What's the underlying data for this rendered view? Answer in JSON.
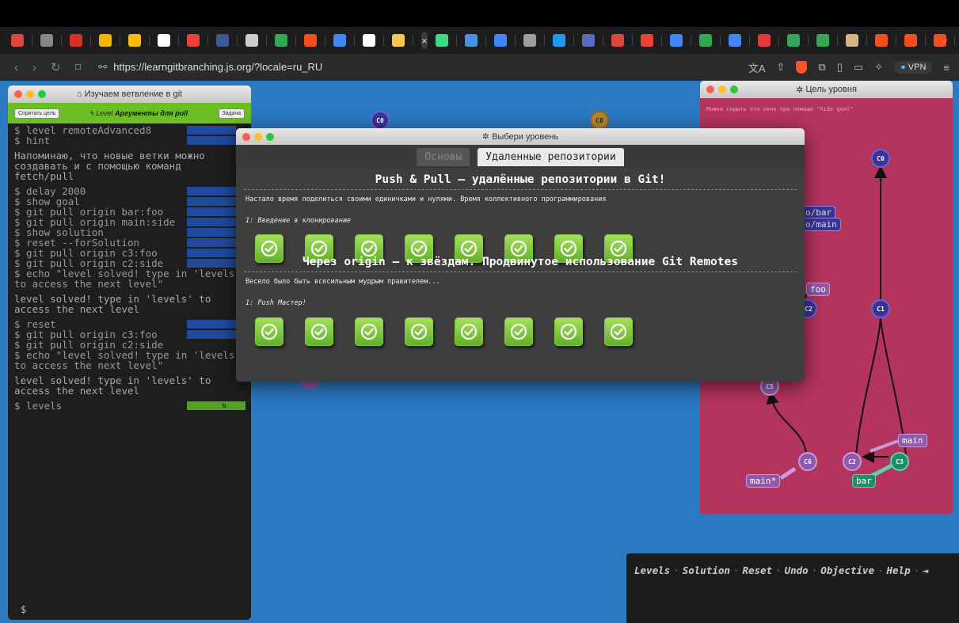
{
  "browser": {
    "url": "https://learngitbranching.js.org/?locale=ru_RU",
    "vpn_label": "VPN",
    "tabs": [
      {
        "color": "#e0453b"
      },
      {
        "color": "#888888"
      },
      {
        "color": "#d93025"
      },
      {
        "color": "#f4b400"
      },
      {
        "color": "#fbbc04"
      },
      {
        "color": "#ffffff"
      },
      {
        "color": "#ea4335"
      },
      {
        "color": "#3b5998"
      },
      {
        "color": "#cccccc"
      },
      {
        "color": "#34a853"
      },
      {
        "color": "#f24e1e"
      },
      {
        "color": "#4285f4"
      },
      {
        "color": "#ffffff"
      },
      {
        "color": "#f9c74f"
      },
      {
        "active": true
      },
      {
        "color": "#3ddc84"
      },
      {
        "color": "#4a90e2"
      },
      {
        "color": "#4285f4"
      },
      {
        "color": "#9e9e9e"
      },
      {
        "color": "#2196f3"
      },
      {
        "color": "#5c6bc0"
      },
      {
        "color": "#e0453b"
      },
      {
        "color": "#ea4335"
      },
      {
        "color": "#4285f4"
      },
      {
        "color": "#34a853"
      },
      {
        "color": "#4285f4"
      },
      {
        "color": "#e53935"
      },
      {
        "color": "#34a853"
      },
      {
        "color": "#34a853"
      },
      {
        "color": "#d4b483"
      },
      {
        "color": "#f24e1e"
      },
      {
        "color": "#f24e1e"
      },
      {
        "color": "#f24e1e"
      },
      {
        "color": "#ea4335"
      }
    ],
    "active_tab_glyph": "×",
    "new_tab_glyph": "+"
  },
  "terminal": {
    "title": "Изучаем ветвление в git",
    "hide_goal_label": "Спрятать цель",
    "level_prefix": "Level",
    "level_name": "Аргументы для pull",
    "task_label": "Задача",
    "lines": [
      {
        "type": "cmd",
        "text": "$ level remoteAdvanced8",
        "hl": "blue"
      },
      {
        "type": "cmd",
        "text": "$ hint",
        "hl": "blue"
      },
      {
        "type": "out",
        "text": "Напоминаю, что новые ветки можно создавать и с помощью команд fetch/pull"
      },
      {
        "type": "cmd",
        "text": "$ delay 2000",
        "hl": "blue"
      },
      {
        "type": "cmd",
        "text": "$ show goal",
        "hl": "blue"
      },
      {
        "type": "cmd",
        "text": "$ git pull origin bar:foo",
        "hl": "blue"
      },
      {
        "type": "cmd",
        "text": "$ git pull origin main:side",
        "hl": "blue"
      },
      {
        "type": "cmd",
        "text": "$ show solution",
        "hl": "blue"
      },
      {
        "type": "cmd",
        "text": "$ reset --forSolution",
        "hl": "blue"
      },
      {
        "type": "cmd",
        "text": "$ git pull origin c3:foo",
        "hl": "blue"
      },
      {
        "type": "cmd",
        "text": "$ git pull origin c2:side",
        "hl": "blue"
      },
      {
        "type": "cmd",
        "text": "$ echo \"level solved! type in 'levels' to access the next level\"",
        "hl": "none"
      },
      {
        "type": "out",
        "text": "level solved! type in 'levels' to access the next level"
      },
      {
        "type": "cmd",
        "text": "$ reset",
        "hl": "blue"
      },
      {
        "type": "cmd",
        "text": "$ git pull origin c3:foo",
        "hl": "blue"
      },
      {
        "type": "cmd",
        "text": "$ git pull origin c2:side",
        "hl": "check"
      },
      {
        "type": "cmd",
        "text": "$ echo \"level solved! type in 'levels' to access the next level\"",
        "hl": "check"
      },
      {
        "type": "out",
        "text": "level solved! type in 'levels' to access the next level"
      },
      {
        "type": "cmd",
        "text": "$ levels",
        "hl": "green"
      }
    ],
    "prompt": "$"
  },
  "goal": {
    "title": "Цель уровня",
    "hint": "Можно скрыть это окно при помощи \"hide goal\"",
    "labels": {
      "origin_bar": "o/bar",
      "origin_main": "o/main",
      "foo": "foo",
      "main_star": "main*",
      "main": "main",
      "bar": "bar"
    },
    "nodes": {
      "c0": "C0",
      "c1": "C1",
      "c2": "C2",
      "c2b": "C2",
      "c3": "C3",
      "c5": "C5",
      "c6": "C6"
    }
  },
  "background_nodes": {
    "a": "C0",
    "b": "C0"
  },
  "modal": {
    "title": "Выбери уровень",
    "tabs": [
      {
        "label": "Основы",
        "active": false
      },
      {
        "label": "Удаленные репозитории",
        "active": true
      }
    ],
    "sections": [
      {
        "heading": "Push & Pull — удалённые репозитории в Git!",
        "description": "Настало время поделиться своими единичками и нулями. Время коллективного программирования",
        "subtitle": "1: Введение в клонирование",
        "levels_completed": 8
      },
      {
        "heading": "Через origin — к звёздам. Продвинутое использование Git Remotes",
        "description": "Весело было быть всесильным мудрым правителем...",
        "subtitle": "1: Push Мастер!",
        "levels_completed": 8
      }
    ]
  },
  "help": {
    "links": [
      "Levels",
      "Solution",
      "Reset",
      "Undo",
      "Objective",
      "Help"
    ],
    "separator": "·",
    "exit_glyph": "⇥"
  },
  "colors": {
    "page_bg": "#2a79c1",
    "goal_bg": "#b5345e",
    "terminal_bar": "#6bbf24",
    "check_green": "#6bbf24"
  }
}
